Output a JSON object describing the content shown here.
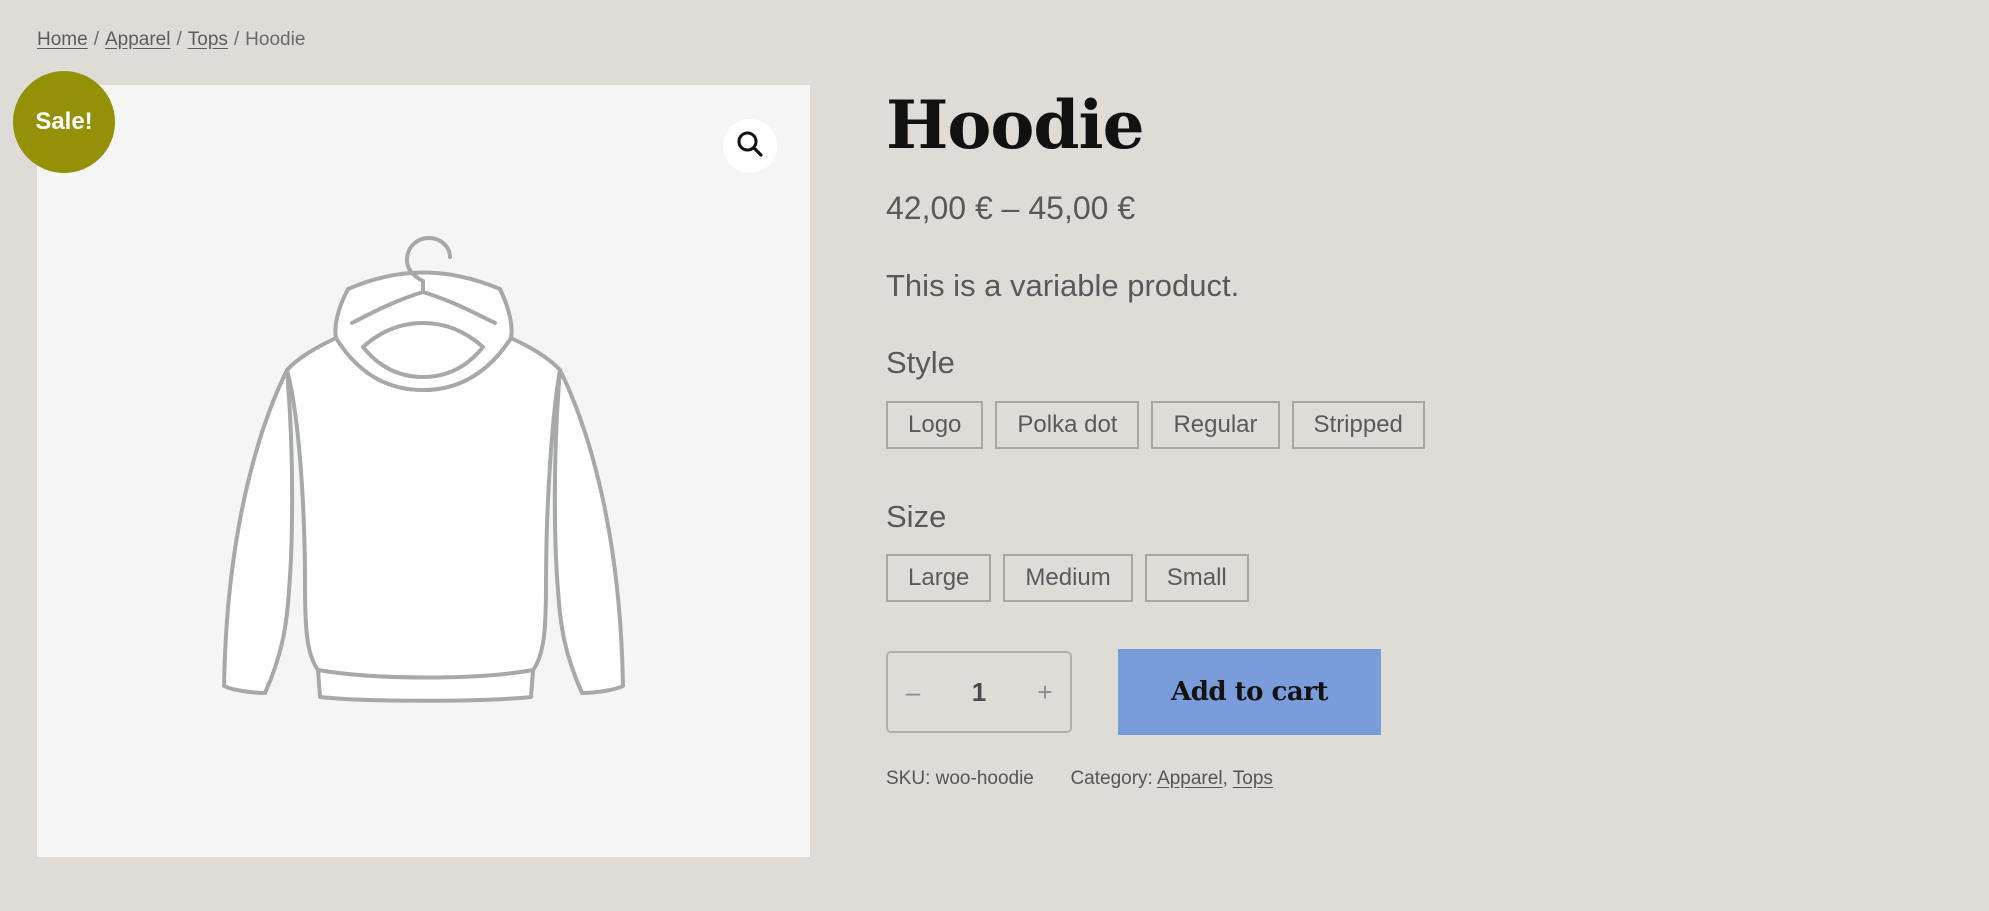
{
  "breadcrumb": {
    "items": [
      "Home",
      "Apparel",
      "Tops"
    ],
    "separator": "/",
    "current": "Hoodie"
  },
  "gallery": {
    "badge": "Sale!",
    "zoom_icon": "magnifier-icon",
    "image_icon": "hoodie-illustration"
  },
  "product": {
    "title": "Hoodie",
    "price": "42,00 € – 45,00 €",
    "description": "This is a variable product.",
    "style": {
      "label": "Style",
      "options": [
        "Logo",
        "Polka dot",
        "Regular",
        "Stripped"
      ]
    },
    "size": {
      "label": "Size",
      "options": [
        "Large",
        "Medium",
        "Small"
      ]
    },
    "quantity": {
      "minus": "–",
      "value": "1",
      "plus": "+"
    },
    "add_to_cart": "Add to cart",
    "meta": {
      "sku_label": "SKU:",
      "sku": "woo-hoodie",
      "category_label": "Category:",
      "categories": [
        "Apparel",
        "Tops"
      ],
      "category_separator": ","
    }
  },
  "colors": {
    "background": "#dfdcd8",
    "badge": "#949109",
    "cart_button": "#7a9cdb",
    "image_bg": "#f4f5f4"
  }
}
